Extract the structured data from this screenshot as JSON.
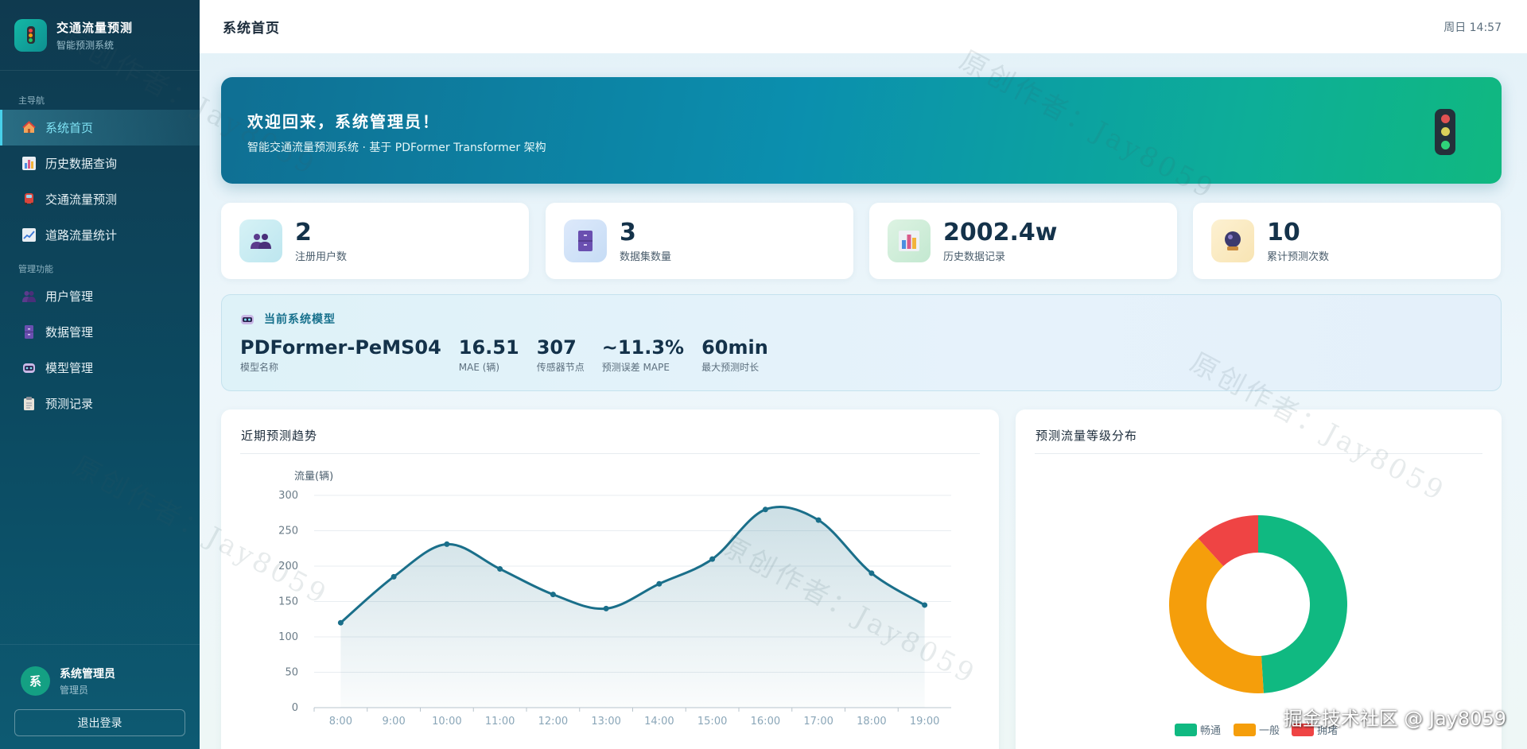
{
  "app": {
    "title": "交通流量预测",
    "subtitle": "智能预测系统"
  },
  "nav": {
    "section_main": "主导航",
    "section_admin": "管理功能",
    "main_items": [
      {
        "label": "系统首页",
        "icon": "house-icon"
      },
      {
        "label": "历史数据查询",
        "icon": "bar-chart-icon"
      },
      {
        "label": "交通流量预测",
        "icon": "car-icon"
      },
      {
        "label": "道路流量统计",
        "icon": "trend-chart-icon"
      }
    ],
    "admin_items": [
      {
        "label": "用户管理",
        "icon": "users-icon"
      },
      {
        "label": "数据管理",
        "icon": "cabinet-icon"
      },
      {
        "label": "模型管理",
        "icon": "robot-icon"
      },
      {
        "label": "预测记录",
        "icon": "clipboard-icon"
      }
    ]
  },
  "user": {
    "avatar": "系",
    "name": "系统管理员",
    "role": "管理员",
    "logout_label": "退出登录"
  },
  "header": {
    "title": "系统首页",
    "clock": "周日 14:57"
  },
  "banner": {
    "title": "欢迎回来，系统管理员！",
    "subtitle": "智能交通流量预测系统 · 基于 PDFormer Transformer 架构"
  },
  "stats": [
    {
      "value": "2",
      "label": "注册用户数",
      "icon": "users-icon"
    },
    {
      "value": "3",
      "label": "数据集数量",
      "icon": "cabinet-icon"
    },
    {
      "value": "2002.4w",
      "label": "历史数据记录",
      "icon": "bar-chart-icon"
    },
    {
      "value": "10",
      "label": "累计预测次数",
      "icon": "crystal-ball-icon"
    }
  ],
  "model": {
    "heading": "当前系统模型",
    "items": [
      {
        "value": "PDFormer-PeMS04",
        "label": "模型名称"
      },
      {
        "value": "16.51",
        "label": "MAE (辆)"
      },
      {
        "value": "307",
        "label": "传感器节点"
      },
      {
        "value": "~11.3%",
        "label": "预测误差 MAPE"
      },
      {
        "value": "60min",
        "label": "最大预测时长"
      }
    ]
  },
  "trend_panel": {
    "title": "近期预测趋势"
  },
  "dist_panel": {
    "title": "预测流量等级分布"
  },
  "colors": {
    "line": "#1a6f8a",
    "smooth": "#10b981",
    "normal": "#f59e0b",
    "jam": "#ef4444",
    "accent": "#47d0ea"
  },
  "chart_data": [
    {
      "type": "line",
      "title": "近期预测趋势",
      "ylabel": "流量(辆)",
      "xlabel": "",
      "x": [
        "8:00",
        "9:00",
        "10:00",
        "11:00",
        "12:00",
        "13:00",
        "14:00",
        "15:00",
        "16:00",
        "17:00",
        "18:00",
        "19:00"
      ],
      "values": [
        120,
        185,
        231,
        196,
        160,
        140,
        175,
        210,
        280,
        265,
        190,
        145
      ],
      "ylim": [
        0,
        300
      ],
      "yticks": [
        0,
        50,
        100,
        150,
        200,
        250,
        300
      ],
      "smooth": true,
      "area_fill": true,
      "grid": true
    },
    {
      "type": "pie",
      "title": "预测流量等级分布",
      "donut": true,
      "labels": [
        "畅通",
        "一般",
        "拥堵"
      ],
      "values": [
        5,
        4,
        1.2
      ],
      "colors": [
        "#10b981",
        "#f59e0b",
        "#ef4444"
      ],
      "legend": "bottom"
    }
  ],
  "watermarks": [
    "原创作者：Jay8059",
    "原创作者：Jay8059",
    "原创作者：Jay8059",
    "原创作者：Jay8059",
    "原创作者：Jay8059"
  ],
  "corner_mark": "掘金技术社区 @ Jay8059"
}
